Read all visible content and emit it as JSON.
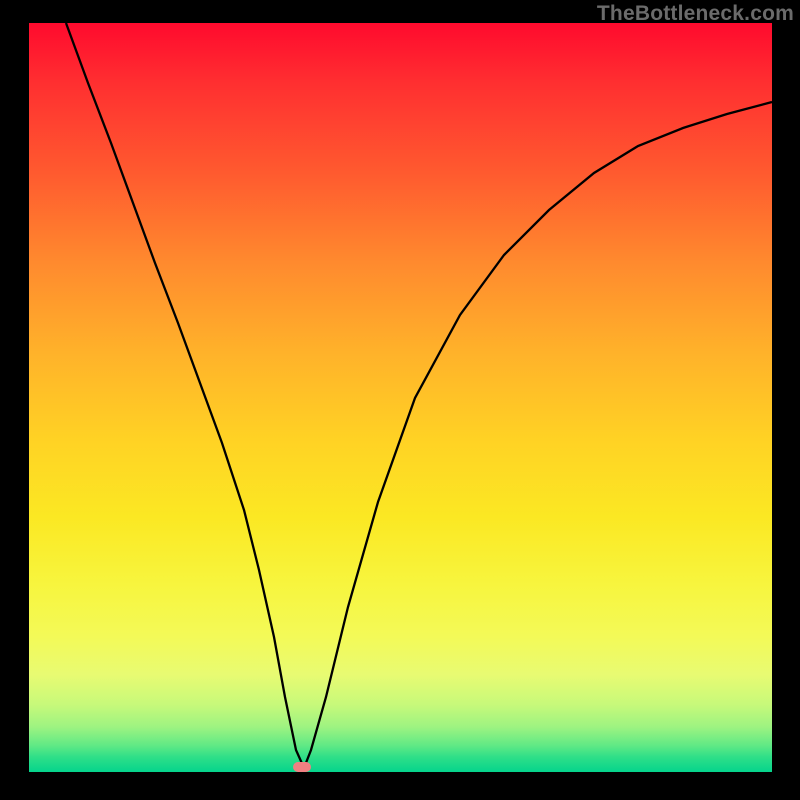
{
  "watermark": "TheBottleneck.com",
  "chart_data": {
    "type": "line",
    "title": "",
    "xlabel": "",
    "ylabel": "",
    "xlim": [
      0,
      100
    ],
    "ylim": [
      0,
      100
    ],
    "series": [
      {
        "name": "bottleneck-curve",
        "x": [
          5,
          8,
          11,
          14,
          17,
          20,
          23,
          26,
          29,
          31,
          33,
          34.5,
          36,
          37,
          38,
          40,
          43,
          47,
          52,
          58,
          64,
          70,
          76,
          82,
          88,
          94,
          100
        ],
        "values": [
          100,
          92,
          84,
          76,
          68,
          60,
          52,
          44,
          35,
          27,
          18,
          10,
          3,
          0.5,
          3,
          10,
          22,
          36,
          50,
          61,
          69,
          75,
          80,
          83.5,
          86,
          88,
          89.5
        ]
      }
    ],
    "marker": {
      "x": 36.5,
      "y": 0.3,
      "name": "optimal-point"
    },
    "grid": false,
    "legend": false,
    "background_gradient": [
      "#ff0a2e",
      "#ffd324",
      "#f7f53e",
      "#05d48c"
    ]
  }
}
